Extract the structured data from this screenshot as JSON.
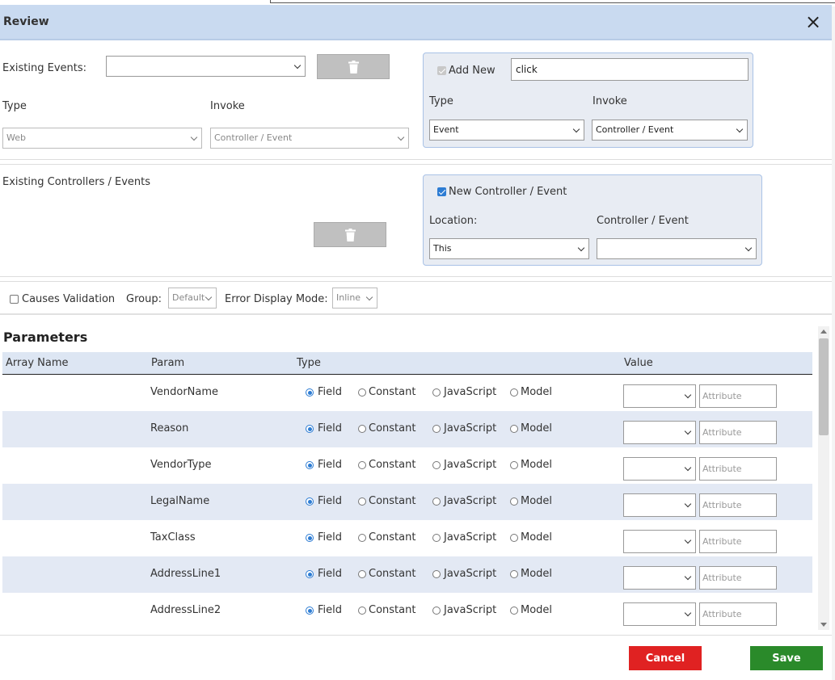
{
  "dialog": {
    "title": "Review",
    "close_icon": "×"
  },
  "events": {
    "existing_label": "Existing Events:",
    "existing_value": "",
    "type_label": "Type",
    "type_value": "Web",
    "invoke_label": "Invoke",
    "invoke_value": "Controller / Event"
  },
  "add_new": {
    "label": "Add New",
    "checked": true,
    "name_value": "click",
    "type_label": "Type",
    "type_value": "Event",
    "invoke_label": "Invoke",
    "invoke_value": "Controller / Event"
  },
  "controllers": {
    "existing_label": "Existing Controllers / Events"
  },
  "new_controller": {
    "label": "New Controller / Event",
    "checked": true,
    "location_label": "Location:",
    "location_value": "This",
    "controller_label": "Controller / Event",
    "controller_value": ""
  },
  "validation": {
    "causes_label": "Causes Validation",
    "group_label": "Group:",
    "group_value": "Default",
    "error_mode_label": "Error Display Mode:",
    "error_mode_value": "Inline"
  },
  "parameters": {
    "title": "Parameters",
    "columns": [
      "Array Name",
      "Param",
      "Type",
      "Value"
    ],
    "type_options": [
      "Field",
      "Constant",
      "JavaScript",
      "Model"
    ],
    "attribute_placeholder": "Attribute",
    "rows": [
      {
        "array_name": "",
        "param": "VendorName",
        "type": "Field"
      },
      {
        "array_name": "",
        "param": "Reason",
        "type": "Field"
      },
      {
        "array_name": "",
        "param": "VendorType",
        "type": "Field"
      },
      {
        "array_name": "",
        "param": "LegalName",
        "type": "Field"
      },
      {
        "array_name": "",
        "param": "TaxClass",
        "type": "Field"
      },
      {
        "array_name": "",
        "param": "AddressLine1",
        "type": "Field"
      },
      {
        "array_name": "",
        "param": "AddressLine2",
        "type": "Field"
      }
    ]
  },
  "footer": {
    "cancel_label": "Cancel",
    "save_label": "Save"
  },
  "colors": {
    "header_bg": "#c9daf0",
    "cancel": "#e02222",
    "save": "#2a8a2a",
    "accent": "#2d7cd3"
  }
}
